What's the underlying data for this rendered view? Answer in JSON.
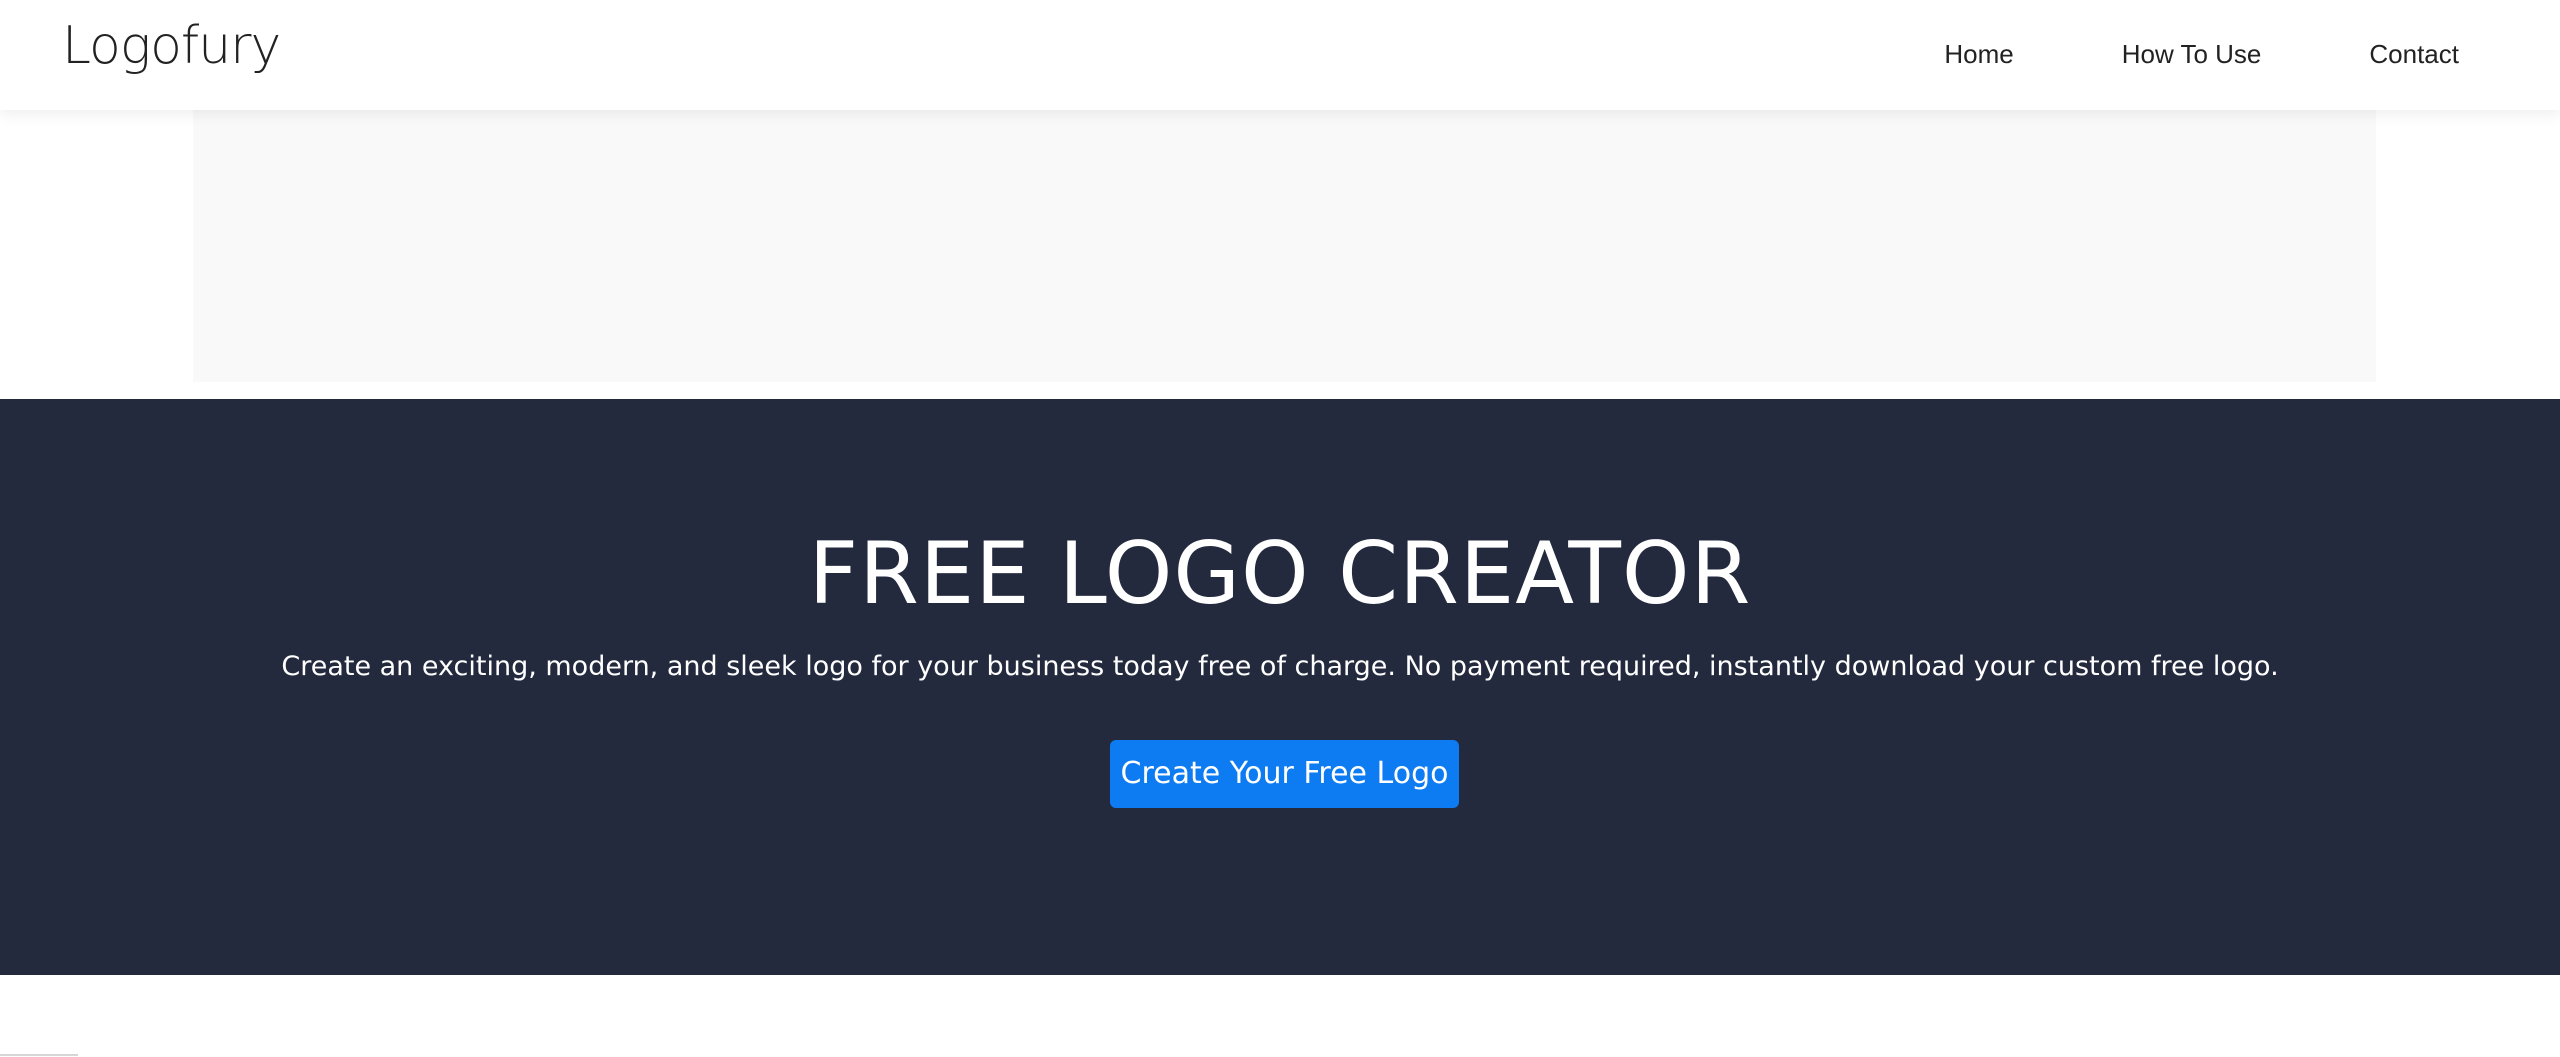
{
  "header": {
    "logo_text": "Logofury",
    "nav": {
      "home": "Home",
      "how_to_use": "How To Use",
      "contact": "Contact"
    }
  },
  "hero": {
    "title": "FREE LOGO CREATOR",
    "subtitle": "Create an exciting, modern, and sleek logo for your business today free of charge. No payment required, instantly download your custom free logo.",
    "cta_label": "Create Your Free Logo"
  },
  "colors": {
    "hero_background": "#232a3e",
    "cta_background": "#0d7bf2",
    "text_dark": "#222222",
    "ad_background": "#f9f9f9"
  }
}
